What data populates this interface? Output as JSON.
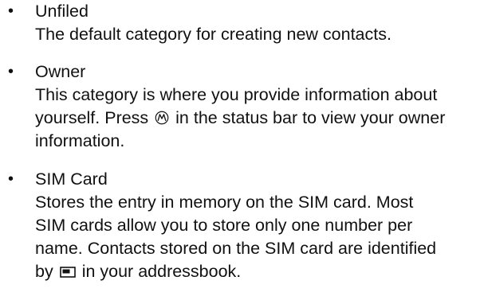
{
  "bullet_glyph": "•",
  "items": [
    {
      "heading": "Unfiled",
      "lines": [
        "The default category for creating new contacts."
      ]
    },
    {
      "heading": "Owner",
      "line1": "This category is where you provide information about",
      "line2_before": "yourself. Press",
      "line2_after": "in the status bar to view your owner",
      "line3": "information.",
      "icon": "motorola-logo-icon"
    },
    {
      "heading": "SIM Card",
      "line1": "Stores the entry in memory on the SIM card. Most",
      "line2": "SIM cards allow you to store only one number per",
      "line3": "name. Contacts stored on the SIM card are identified",
      "line4_before": "by",
      "line4_after": "in your addressbook.",
      "icon": "sim-card-icon"
    }
  ]
}
